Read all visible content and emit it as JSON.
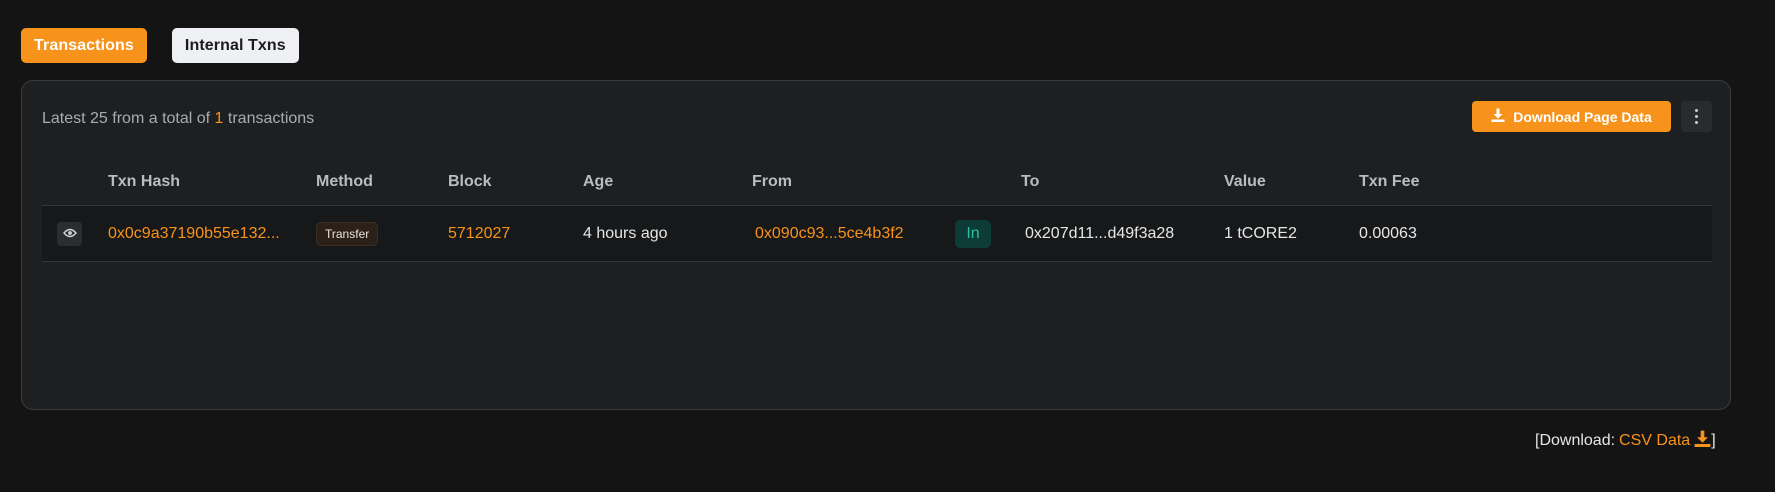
{
  "tabs": [
    {
      "label": "Transactions",
      "active": true
    },
    {
      "label": "Internal Txns",
      "active": false
    }
  ],
  "summary": {
    "prefix": "Latest 25 from a total of ",
    "count": "1",
    "suffix": " transactions"
  },
  "toolbar": {
    "download_label": "Download Page Data",
    "download_icon": "download-icon",
    "more_icon": "more-vertical-icon"
  },
  "table": {
    "headers": [
      "Txn Hash",
      "Method",
      "Block",
      "Age",
      "From",
      "To",
      "Value",
      "Txn Fee"
    ],
    "rows": [
      {
        "txn_hash": "0x0c9a37190b55e132...",
        "method": "Transfer",
        "block": "5712027",
        "age": "4 hours ago",
        "from": "0x090c93...5ce4b3f2",
        "direction": "In",
        "to": "0x207d11...d49f3a28",
        "value": "1 tCORE2",
        "txn_fee": "0.00063"
      }
    ]
  },
  "footer": {
    "prefix": "[Download: ",
    "link": "CSV Data",
    "suffix": " ]"
  },
  "colors": {
    "accent": "#f7931a",
    "background": "#141414",
    "card": "#1e1f21",
    "in_badge": "#2bc0a4"
  }
}
